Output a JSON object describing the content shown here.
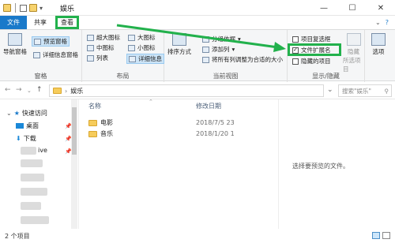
{
  "window": {
    "title": "娱乐",
    "minimize": "—",
    "maximize": "☐",
    "close": "✕"
  },
  "tabs": {
    "file": "文件",
    "share": "共享",
    "view": "查看"
  },
  "ribbon": {
    "pane": {
      "nav_pane": "导航窗格",
      "preview_pane": "预览窗格",
      "details_pane": "详细信息窗格",
      "label": "窗格"
    },
    "layout": {
      "xl_icons": "超大图标",
      "large_icons": "大图标",
      "medium_icons": "中图标",
      "small_icons": "小图标",
      "list": "列表",
      "details": "详细信息",
      "label": "布局"
    },
    "current_view": {
      "sort_by": "排序方式",
      "group_by": "分组依据",
      "add_columns": "添加列",
      "size_all": "将所有列调整为合适的大小",
      "label": "当前视图"
    },
    "show_hide": {
      "item_checkboxes": "项目复选框",
      "file_extensions": "文件扩展名",
      "hidden_items": "隐藏的项目",
      "hide_selected": "隐藏",
      "hide_selected2": "所选项目",
      "label": "显示/隐藏"
    },
    "options": "选项"
  },
  "address": {
    "path": "娱乐",
    "search_placeholder": "搜索\"娱乐\""
  },
  "nav": {
    "quick_access": "快速访问",
    "desktop": "桌面",
    "downloads": "下载",
    "drive_suffix": "ive"
  },
  "columns": {
    "name": "名称",
    "modified": "修改日期"
  },
  "files": [
    {
      "name": "电影",
      "date": "2018/7/5 23"
    },
    {
      "name": "音乐",
      "date": "2018/1/20 1"
    }
  ],
  "preview_text": "选择要预览的文件。",
  "status": {
    "count": "2 个项目"
  },
  "colors": {
    "accent": "#1979ca",
    "highlight": "#22b14c",
    "folder": "#f6cc5b"
  }
}
